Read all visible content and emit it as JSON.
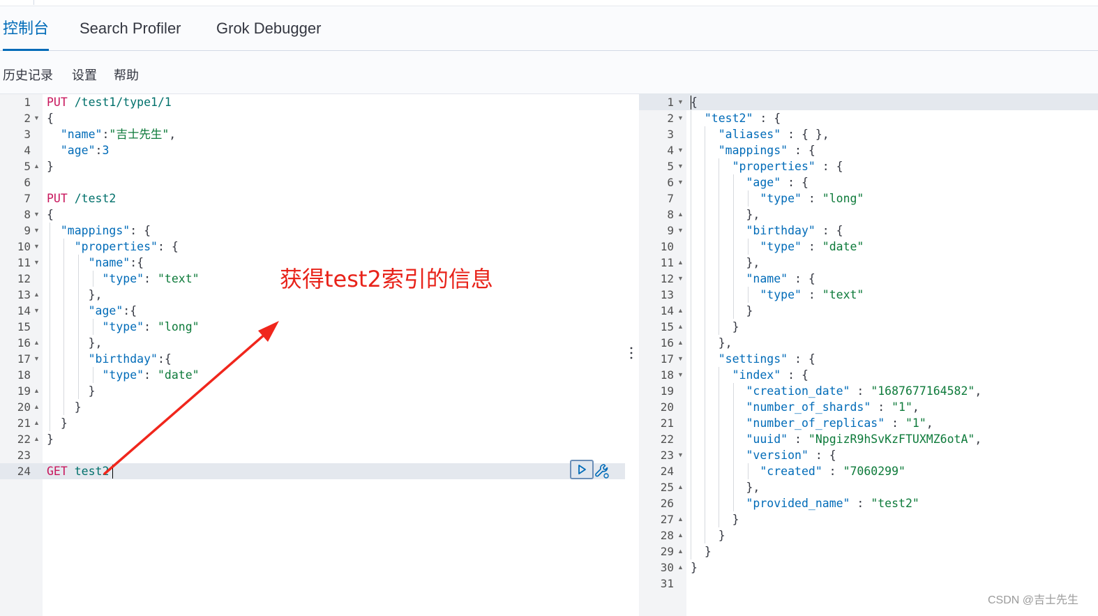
{
  "tabs": [
    {
      "label": "控制台",
      "active": true
    },
    {
      "label": "Search Profiler",
      "active": false
    },
    {
      "label": "Grok Debugger",
      "active": false
    }
  ],
  "toolbar": {
    "history": "历史记录",
    "settings": "设置",
    "help": "帮助"
  },
  "request": {
    "lines": [
      [
        [
          "PUT ",
          "method"
        ],
        [
          "/test1/type1/1",
          "url"
        ]
      ],
      [
        [
          "{",
          "punc"
        ]
      ],
      [
        [
          "  ",
          ""
        ],
        [
          "\"name\"",
          "key"
        ],
        [
          ":",
          "punc"
        ],
        [
          "\"吉士先生\"",
          "str"
        ],
        [
          ",",
          "punc"
        ]
      ],
      [
        [
          "  ",
          ""
        ],
        [
          "\"age\"",
          "key"
        ],
        [
          ":",
          "punc"
        ],
        [
          "3",
          "num"
        ]
      ],
      [
        [
          "}",
          "punc"
        ]
      ],
      [],
      [
        [
          "PUT ",
          "method"
        ],
        [
          "/test2",
          "url"
        ]
      ],
      [
        [
          "{",
          "punc"
        ]
      ],
      [
        [
          "  ",
          ""
        ],
        [
          "\"mappings\"",
          "key"
        ],
        [
          ": {",
          "punc"
        ]
      ],
      [
        [
          "    ",
          ""
        ],
        [
          "\"properties\"",
          "key"
        ],
        [
          ": {",
          "punc"
        ]
      ],
      [
        [
          "      ",
          ""
        ],
        [
          "\"name\"",
          "key"
        ],
        [
          ":{",
          "punc"
        ]
      ],
      [
        [
          "        ",
          ""
        ],
        [
          "\"type\"",
          "key"
        ],
        [
          ": ",
          "punc"
        ],
        [
          "\"text\"",
          "str"
        ]
      ],
      [
        [
          "      ",
          ""
        ],
        [
          "},",
          "punc"
        ]
      ],
      [
        [
          "      ",
          ""
        ],
        [
          "\"age\"",
          "key"
        ],
        [
          ":{",
          "punc"
        ]
      ],
      [
        [
          "        ",
          ""
        ],
        [
          "\"type\"",
          "key"
        ],
        [
          ": ",
          "punc"
        ],
        [
          "\"long\"",
          "str"
        ]
      ],
      [
        [
          "      ",
          ""
        ],
        [
          "},",
          "punc"
        ]
      ],
      [
        [
          "      ",
          ""
        ],
        [
          "\"birthday\"",
          "key"
        ],
        [
          ":{",
          "punc"
        ]
      ],
      [
        [
          "        ",
          ""
        ],
        [
          "\"type\"",
          "key"
        ],
        [
          ": ",
          "punc"
        ],
        [
          "\"date\"",
          "str"
        ]
      ],
      [
        [
          "      ",
          ""
        ],
        [
          "}",
          "punc"
        ]
      ],
      [
        [
          "    ",
          ""
        ],
        [
          "}",
          "punc"
        ]
      ],
      [
        [
          "  ",
          ""
        ],
        [
          "}",
          "punc"
        ]
      ],
      [
        [
          "}",
          "punc"
        ]
      ],
      [],
      [
        [
          "GET ",
          "method"
        ],
        [
          "test2",
          "url"
        ]
      ]
    ],
    "folds": {
      "2": "down",
      "5": "up",
      "8": "down",
      "9": "down",
      "10": "down",
      "11": "down",
      "13": "up",
      "14": "down",
      "16": "up",
      "17": "down",
      "19": "up",
      "20": "up",
      "21": "up",
      "22": "up"
    }
  },
  "response": {
    "lines": [
      [
        [
          "{",
          "punc"
        ]
      ],
      [
        [
          "  ",
          ""
        ],
        [
          "\"test2\"",
          "key"
        ],
        [
          " : {",
          "punc"
        ]
      ],
      [
        [
          "    ",
          ""
        ],
        [
          "\"aliases\"",
          "key"
        ],
        [
          " : { },",
          "punc"
        ]
      ],
      [
        [
          "    ",
          ""
        ],
        [
          "\"mappings\"",
          "key"
        ],
        [
          " : {",
          "punc"
        ]
      ],
      [
        [
          "      ",
          ""
        ],
        [
          "\"properties\"",
          "key"
        ],
        [
          " : {",
          "punc"
        ]
      ],
      [
        [
          "        ",
          ""
        ],
        [
          "\"age\"",
          "key"
        ],
        [
          " : {",
          "punc"
        ]
      ],
      [
        [
          "          ",
          ""
        ],
        [
          "\"type\"",
          "key"
        ],
        [
          " : ",
          "punc"
        ],
        [
          "\"long\"",
          "str"
        ]
      ],
      [
        [
          "        ",
          ""
        ],
        [
          "},",
          "punc"
        ]
      ],
      [
        [
          "        ",
          ""
        ],
        [
          "\"birthday\"",
          "key"
        ],
        [
          " : {",
          "punc"
        ]
      ],
      [
        [
          "          ",
          ""
        ],
        [
          "\"type\"",
          "key"
        ],
        [
          " : ",
          "punc"
        ],
        [
          "\"date\"",
          "str"
        ]
      ],
      [
        [
          "        ",
          ""
        ],
        [
          "},",
          "punc"
        ]
      ],
      [
        [
          "        ",
          ""
        ],
        [
          "\"name\"",
          "key"
        ],
        [
          " : {",
          "punc"
        ]
      ],
      [
        [
          "          ",
          ""
        ],
        [
          "\"type\"",
          "key"
        ],
        [
          " : ",
          "punc"
        ],
        [
          "\"text\"",
          "str"
        ]
      ],
      [
        [
          "        ",
          ""
        ],
        [
          "}",
          "punc"
        ]
      ],
      [
        [
          "      ",
          ""
        ],
        [
          "}",
          "punc"
        ]
      ],
      [
        [
          "    ",
          ""
        ],
        [
          "},",
          "punc"
        ]
      ],
      [
        [
          "    ",
          ""
        ],
        [
          "\"settings\"",
          "key"
        ],
        [
          " : {",
          "punc"
        ]
      ],
      [
        [
          "      ",
          ""
        ],
        [
          "\"index\"",
          "key"
        ],
        [
          " : {",
          "punc"
        ]
      ],
      [
        [
          "        ",
          ""
        ],
        [
          "\"creation_date\"",
          "key"
        ],
        [
          " : ",
          "punc"
        ],
        [
          "\"1687677164582\"",
          "str"
        ],
        [
          ",",
          "punc"
        ]
      ],
      [
        [
          "        ",
          ""
        ],
        [
          "\"number_of_shards\"",
          "key"
        ],
        [
          " : ",
          "punc"
        ],
        [
          "\"1\"",
          "str"
        ],
        [
          ",",
          "punc"
        ]
      ],
      [
        [
          "        ",
          ""
        ],
        [
          "\"number_of_replicas\"",
          "key"
        ],
        [
          " : ",
          "punc"
        ],
        [
          "\"1\"",
          "str"
        ],
        [
          ",",
          "punc"
        ]
      ],
      [
        [
          "        ",
          ""
        ],
        [
          "\"uuid\"",
          "key"
        ],
        [
          " : ",
          "punc"
        ],
        [
          "\"NpgizR9hSvKzFTUXMZ6otA\"",
          "str"
        ],
        [
          ",",
          "punc"
        ]
      ],
      [
        [
          "        ",
          ""
        ],
        [
          "\"version\"",
          "key"
        ],
        [
          " : {",
          "punc"
        ]
      ],
      [
        [
          "          ",
          ""
        ],
        [
          "\"created\"",
          "key"
        ],
        [
          " : ",
          "punc"
        ],
        [
          "\"7060299\"",
          "str"
        ]
      ],
      [
        [
          "        ",
          ""
        ],
        [
          "},",
          "punc"
        ]
      ],
      [
        [
          "        ",
          ""
        ],
        [
          "\"provided_name\"",
          "key"
        ],
        [
          " : ",
          "punc"
        ],
        [
          "\"test2\"",
          "str"
        ]
      ],
      [
        [
          "      ",
          ""
        ],
        [
          "}",
          "punc"
        ]
      ],
      [
        [
          "    ",
          ""
        ],
        [
          "}",
          "punc"
        ]
      ],
      [
        [
          "  ",
          ""
        ],
        [
          "}",
          "punc"
        ]
      ],
      [
        [
          "}",
          "punc"
        ]
      ],
      []
    ],
    "folds": {
      "1": "down",
      "2": "down",
      "4": "down",
      "5": "down",
      "6": "down",
      "8": "up",
      "9": "down",
      "11": "up",
      "12": "down",
      "14": "up",
      "15": "up",
      "16": "up",
      "17": "down",
      "18": "down",
      "23": "down",
      "25": "up",
      "27": "up",
      "28": "up",
      "29": "up",
      "30": "up"
    }
  },
  "annotation": "获得test2索引的信息",
  "watermark": "CSDN @吉士先生",
  "icons": {
    "run": "play-icon",
    "wrench": "wrench-icon",
    "resize": "vertical-dots-icon"
  },
  "colors": {
    "accent": "#006bb8",
    "annotation": "#e8231a",
    "method": "#c8165c",
    "string": "#0d7a3a"
  }
}
